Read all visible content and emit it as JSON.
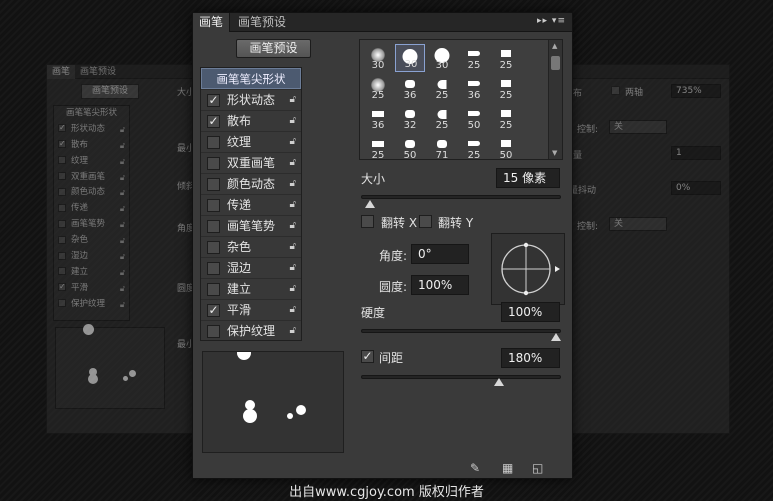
{
  "ghost_left": {
    "tabs": [
      "画笔",
      "画笔预设"
    ],
    "preset_button": "画笔预设",
    "list_header": "画笔笔尖形状",
    "items": [
      {
        "label": "形状动态",
        "checked": true
      },
      {
        "label": "散布",
        "checked": true
      },
      {
        "label": "纹理",
        "checked": false
      },
      {
        "label": "双重画笔",
        "checked": false
      },
      {
        "label": "颜色动态",
        "checked": false
      },
      {
        "label": "传递",
        "checked": false
      },
      {
        "label": "画笔笔势",
        "checked": false
      },
      {
        "label": "杂色",
        "checked": false
      },
      {
        "label": "湿边",
        "checked": false
      },
      {
        "label": "建立",
        "checked": false
      },
      {
        "label": "平滑",
        "checked": true
      },
      {
        "label": "保护纹理",
        "checked": false
      }
    ],
    "fragments": [
      "大小",
      "最小",
      "倾斜",
      "角度",
      "圆度",
      "最小"
    ]
  },
  "ghost_right": {
    "flip_y_label": "两轴",
    "value_1": "735%",
    "control_label_1": "控制:",
    "control_value_1": "关",
    "value_2": "1",
    "jitter_label": "量抖动",
    "value_3": "0%",
    "control_label_2": "控制:",
    "control_value_2": "关",
    "fragments": [
      "布",
      "量"
    ]
  },
  "main": {
    "tabs": [
      "画笔",
      "画笔预设"
    ],
    "tab_menu": "▸▸ ▾≡",
    "preset_button": "画笔预设",
    "list_header": "画笔笔尖形状",
    "items": [
      {
        "label": "形状动态",
        "checked": true
      },
      {
        "label": "散布",
        "checked": true
      },
      {
        "label": "纹理",
        "checked": false
      },
      {
        "label": "双重画笔",
        "checked": false
      },
      {
        "label": "颜色动态",
        "checked": false
      },
      {
        "label": "传递",
        "checked": false
      },
      {
        "label": "画笔笔势",
        "checked": false
      },
      {
        "label": "杂色",
        "checked": false
      },
      {
        "label": "湿边",
        "checked": false
      },
      {
        "label": "建立",
        "checked": false
      },
      {
        "label": "平滑",
        "checked": true
      },
      {
        "label": "保护纹理",
        "checked": false
      }
    ],
    "brush_grid": [
      [
        "30",
        "30",
        "30",
        "25",
        "25"
      ],
      [
        "25",
        "36",
        "25",
        "36",
        "25"
      ],
      [
        "36",
        "32",
        "25",
        "50",
        "25"
      ],
      [
        "25",
        "50",
        "71",
        "25",
        "50"
      ]
    ],
    "selected_brush": {
      "row": 0,
      "col": 1
    },
    "size_label": "大小",
    "size_value": "15 像素",
    "size_fraction": 0.02,
    "flip_x_label": "翻转 X",
    "flip_y_label": "翻转 Y",
    "angle_label": "角度:",
    "angle_value": "0°",
    "roundness_label": "圆度:",
    "roundness_value": "100%",
    "hardness_label": "硬度",
    "hardness_value": "100%",
    "hardness_fraction": 1.0,
    "spacing_label": "间距",
    "spacing_checked": true,
    "spacing_value": "180%",
    "spacing_fraction": 0.7,
    "bottom_icons": [
      "brush-toggle-icon",
      "grid-icon",
      "new-brush-icon"
    ]
  },
  "caption": "出自www.cgjoy.com 版权归作者"
}
